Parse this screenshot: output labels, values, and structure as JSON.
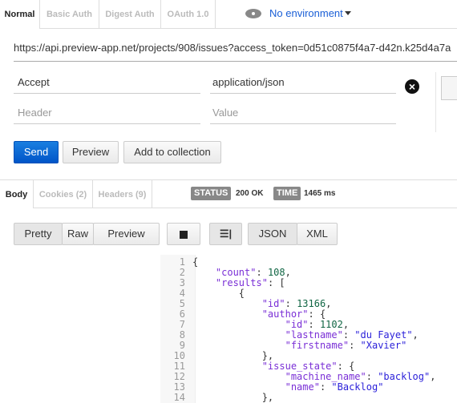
{
  "request_tabs": [
    "Normal",
    "Basic Auth",
    "Digest Auth",
    "OAuth 1.0"
  ],
  "environment": {
    "icon": "eye-icon",
    "label": "No environment"
  },
  "url": "https://api.preview-app.net/projects/908/issues?access_token=0d51c0875f4a7-d42n.k25d4a7a",
  "headers": [
    {
      "key": "Accept",
      "value": "application/json"
    }
  ],
  "header_placeholder": {
    "key": "Header",
    "value": "Value"
  },
  "actions": {
    "send": "Send",
    "preview": "Preview",
    "add": "Add to collection"
  },
  "response_tabs": [
    "Body",
    "Cookies (2)",
    "Headers (9)"
  ],
  "status": {
    "label": "STATUS",
    "value": "200 OK"
  },
  "time": {
    "label": "TIME",
    "value": "1465 ms"
  },
  "view_modes": [
    "Pretty",
    "Raw",
    "Preview"
  ],
  "formats": [
    "JSON",
    "XML"
  ],
  "code_lines": [
    [
      [
        "p",
        "{"
      ]
    ],
    [
      [
        "p",
        "    "
      ],
      [
        "k",
        "\"count\""
      ],
      [
        "p",
        ": "
      ],
      [
        "n",
        "108"
      ],
      [
        "p",
        ","
      ]
    ],
    [
      [
        "p",
        "    "
      ],
      [
        "k",
        "\"results\""
      ],
      [
        "p",
        ": ["
      ]
    ],
    [
      [
        "p",
        "        {"
      ]
    ],
    [
      [
        "p",
        "            "
      ],
      [
        "k",
        "\"id\""
      ],
      [
        "p",
        ": "
      ],
      [
        "n",
        "13166"
      ],
      [
        "p",
        ","
      ]
    ],
    [
      [
        "p",
        "            "
      ],
      [
        "k",
        "\"author\""
      ],
      [
        "p",
        ": {"
      ]
    ],
    [
      [
        "p",
        "                "
      ],
      [
        "k",
        "\"id\""
      ],
      [
        "p",
        ": "
      ],
      [
        "n",
        "1102"
      ],
      [
        "p",
        ","
      ]
    ],
    [
      [
        "p",
        "                "
      ],
      [
        "k",
        "\"lastname\""
      ],
      [
        "p",
        ": "
      ],
      [
        "s",
        "\"du Fayet\""
      ],
      [
        "p",
        ","
      ]
    ],
    [
      [
        "p",
        "                "
      ],
      [
        "k",
        "\"firstname\""
      ],
      [
        "p",
        ": "
      ],
      [
        "s",
        "\"Xavier\""
      ]
    ],
    [
      [
        "p",
        "            },"
      ]
    ],
    [
      [
        "p",
        "            "
      ],
      [
        "k",
        "\"issue_state\""
      ],
      [
        "p",
        ": {"
      ]
    ],
    [
      [
        "p",
        "                "
      ],
      [
        "k",
        "\"machine_name\""
      ],
      [
        "p",
        ": "
      ],
      [
        "s",
        "\"backlog\""
      ],
      [
        "p",
        ","
      ]
    ],
    [
      [
        "p",
        "                "
      ],
      [
        "k",
        "\"name\""
      ],
      [
        "p",
        ": "
      ],
      [
        "s",
        "\"Backlog\""
      ]
    ],
    [
      [
        "p",
        "            },"
      ]
    ]
  ]
}
